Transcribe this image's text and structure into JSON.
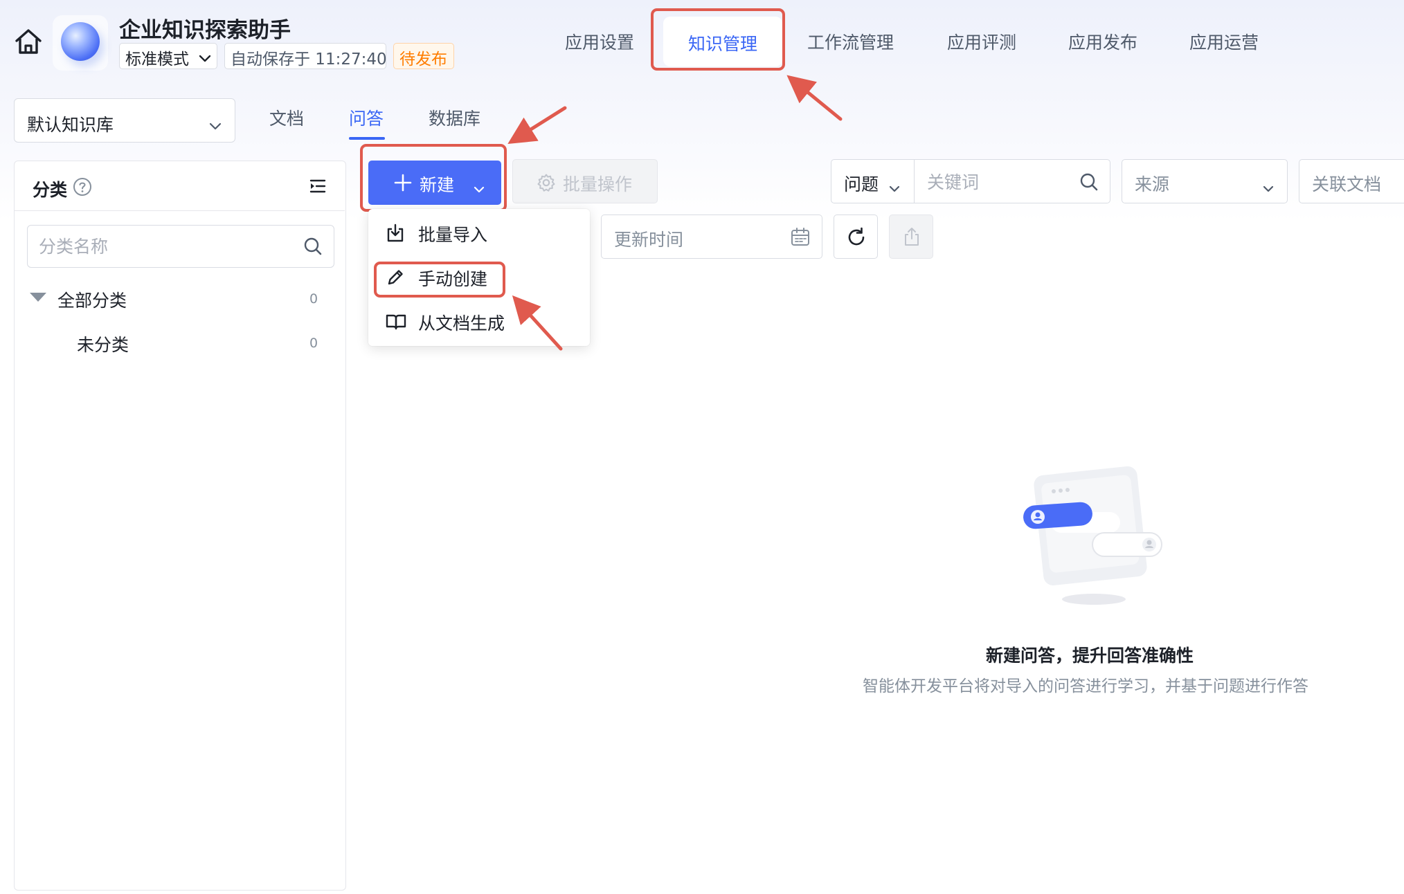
{
  "header": {
    "app_title": "企业知识探索助手",
    "mode": "标准模式",
    "autosave": "自动保存于 11:27:40",
    "status_badge": "待发布"
  },
  "top_nav": {
    "items": [
      "应用设置",
      "知识管理",
      "工作流管理",
      "应用评测",
      "应用发布",
      "应用运营"
    ],
    "active": "知识管理"
  },
  "knowledge_base": {
    "selected": "默认知识库"
  },
  "sub_tabs": {
    "items": [
      "文档",
      "问答",
      "数据库"
    ],
    "active": "问答"
  },
  "category_panel": {
    "title": "分类",
    "search_placeholder": "分类名称",
    "tree": [
      {
        "label": "全部分类",
        "count": "0"
      },
      {
        "label": "未分类",
        "count": "0"
      }
    ]
  },
  "toolbar": {
    "new_label": "新建",
    "batch_label": "批量操作",
    "question_select": "问题",
    "keyword_placeholder": "关键词",
    "source_placeholder": "来源",
    "related_doc_placeholder": "关联文档",
    "update_time_placeholder": "更新时间"
  },
  "new_menu": {
    "items": [
      {
        "label": "批量导入",
        "icon": "import-icon"
      },
      {
        "label": "手动创建",
        "icon": "pencil-icon"
      },
      {
        "label": "从文档生成",
        "icon": "book-icon"
      }
    ]
  },
  "empty_state": {
    "title": "新建问答，提升回答准确性",
    "description": "智能体开发平台将对导入的问答进行学习，并基于问题进行作答"
  },
  "colors": {
    "accent": "#4a6cf7",
    "highlight": "#e05a4e",
    "pending": "#ff7d00"
  }
}
